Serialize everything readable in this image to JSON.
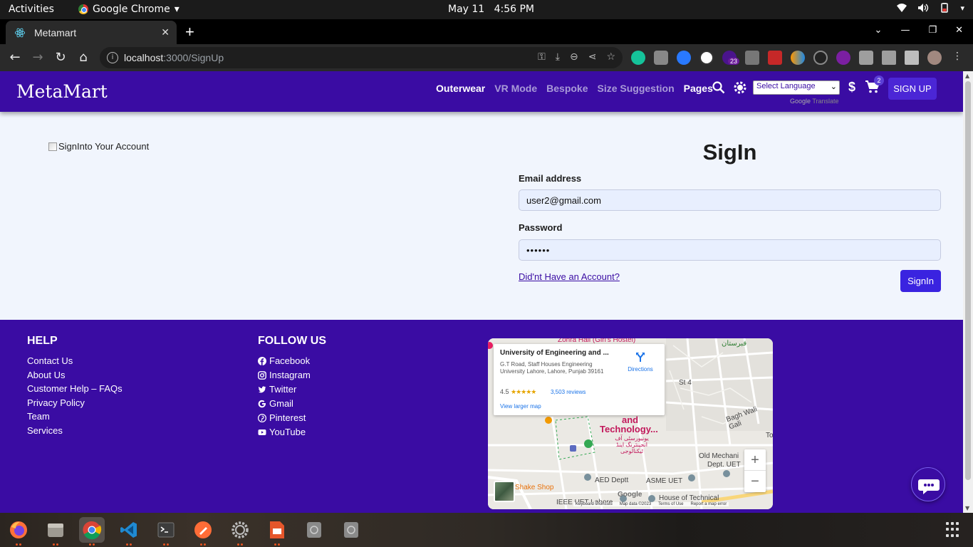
{
  "system_bar": {
    "activities": "Activities",
    "app_name": "Google Chrome",
    "date": "May 11",
    "time": "4:56 PM"
  },
  "browser": {
    "tab_title": "Metamart",
    "url_host": "localhost",
    "url_path": ":3000/SignUp",
    "extension_badge": "23"
  },
  "navbar": {
    "brand": "MetaMart",
    "links": [
      "Outerwear",
      "VR Mode",
      "Bespoke",
      "Size Suggestion",
      "Pages"
    ],
    "language_select": "Select Language",
    "translate_powered": "Google",
    "translate_label": "Translate",
    "currency_symbol": "$",
    "cart_count": "2",
    "signup_label": "SIGN UP"
  },
  "signin": {
    "image_alt": "SignInto Your Account",
    "title": "SigIn",
    "email_label": "Email address",
    "email_value": "user2@gmail.com",
    "password_label": "Password",
    "password_value": "••••••",
    "account_link": "Did'nt Have an Account?",
    "submit_label": "SignIn"
  },
  "footer": {
    "help_title": "HELP",
    "help_links": [
      "Contact Us",
      "About Us",
      "Customer Help – FAQs",
      "Privacy Policy",
      "Team",
      "Services"
    ],
    "follow_title": "FOLLOW US",
    "social_links": [
      "Facebook",
      "Instagram",
      "Twitter",
      "Gmail",
      "Pinterest",
      "YouTube"
    ]
  },
  "map": {
    "place_name": "University of Engineering and ...",
    "address": "G.T Road, Staff Houses Engineering University Lahore, Lahore, Punjab 39161",
    "rating": "4.5",
    "stars": "★★★★★",
    "reviews": "3,503 reviews",
    "view_larger": "View larger map",
    "directions": "Directions",
    "labels": {
      "hostel": "Zohra Hall (Girl's Hostel)",
      "tech": "and",
      "tech2": "Technology...",
      "urdu": "یونیورسٹی آف انجینئرنگ اینڈ ٹیکنالوجی",
      "st4": "St 4",
      "bagh": "Bagh Wali Gali",
      "old_mech": "Old Mechani",
      "dept": "Dept. UET",
      "aed": "AED Deptt",
      "asme": "ASME UET",
      "shake": "Shake Shop",
      "ieee": "IEEE UET Lahore",
      "house": "House of Technical",
      "qabrastan": "قبرستان",
      "to": "To"
    },
    "footer_items": [
      "Keyboard shortcuts",
      "Map data ©2023",
      "Terms of Use",
      "Report a map error"
    ],
    "google": "Google",
    "zoom_in": "+",
    "zoom_out": "−"
  },
  "colors": {
    "brand": "#3a0ca3",
    "button": "#3a23e0",
    "page_bg": "#f1f5fd"
  }
}
